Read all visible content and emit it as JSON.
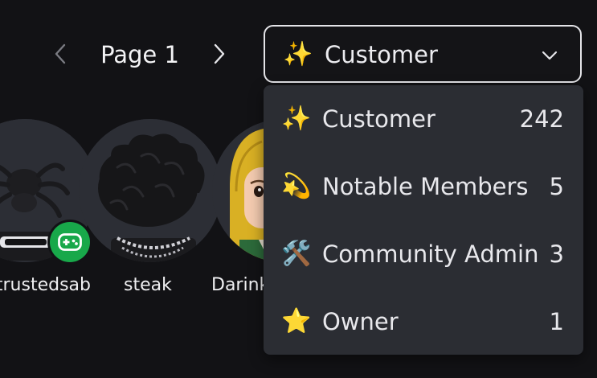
{
  "pager": {
    "label": "Page 1",
    "prev_icon": "chevron-left-icon",
    "next_icon": "chevron-right-icon"
  },
  "role_select": {
    "emoji": "✨",
    "value": "Customer",
    "chevron_icon": "chevron-down-icon"
  },
  "role_menu": {
    "items": [
      {
        "emoji": "✨",
        "label": "Customer",
        "count": "242"
      },
      {
        "emoji": "💫",
        "label": "Notable Members",
        "count": "5"
      },
      {
        "emoji": "🛠️",
        "label": "Community Admin",
        "count": "3"
      },
      {
        "emoji": "⭐",
        "label": "Owner",
        "count": "1"
      }
    ]
  },
  "members": [
    {
      "name": "trustedsab",
      "badge_icon": "gamepad-icon"
    },
    {
      "name": "steak"
    },
    {
      "name": "Darink"
    }
  ],
  "colors": {
    "background": "#121215",
    "menu_background": "#2b2d33",
    "avatar_background": "#2c2e35",
    "badge_green": "#18a84a",
    "select_border": "#e4e4e8"
  }
}
